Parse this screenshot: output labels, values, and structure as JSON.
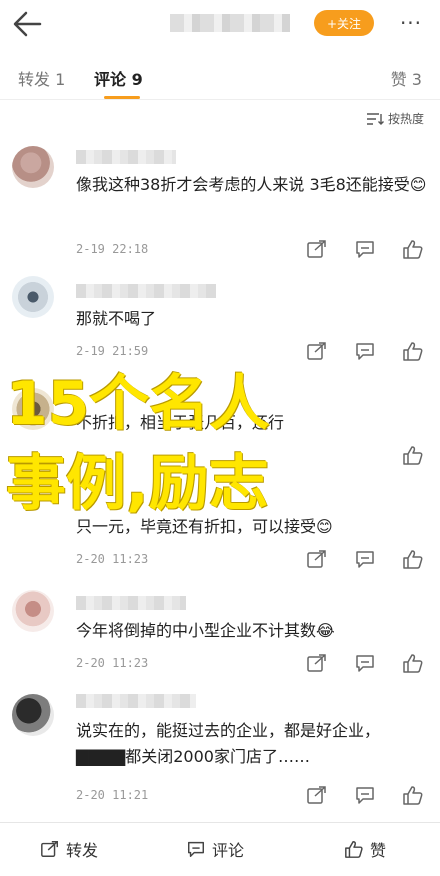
{
  "header": {
    "follow_label": "+关注",
    "more_label": "···"
  },
  "tabs": [
    {
      "label": "转发 1"
    },
    {
      "label": "评论 9"
    },
    {
      "label": "赞 3"
    }
  ],
  "sort_label": "按热度",
  "comments": [
    {
      "text": "像我这种38折才会考虑的人来说 3毛8还能接受😊",
      "time": "2-19 22:18"
    },
    {
      "text": "那就不喝了",
      "time": "2-19 21:59"
    },
    {
      "text": "不折扣，相当于张几百，还行",
      "time": "2-19 21:52"
    },
    {
      "text": "只一元，毕竟还有折扣，可以接受😊",
      "time": "2-20 11:23"
    },
    {
      "text": "今年将倒掉的中小型企业不计其数😂",
      "time": "2-20 11:23"
    },
    {
      "text": "说实在的，能挺过去的企业，都是好企业，▇▇▇▇都关闭2000家门店了……",
      "time": "2-20 11:21"
    }
  ],
  "overlay": {
    "line1": "15个名人",
    "line2": "事例,励志"
  },
  "bottom": {
    "repost_label": "转发",
    "comment_label": "评论",
    "like_label": "赞"
  },
  "colors": {
    "accent": "#f79d1d",
    "overlay_text": "#ffe600"
  }
}
